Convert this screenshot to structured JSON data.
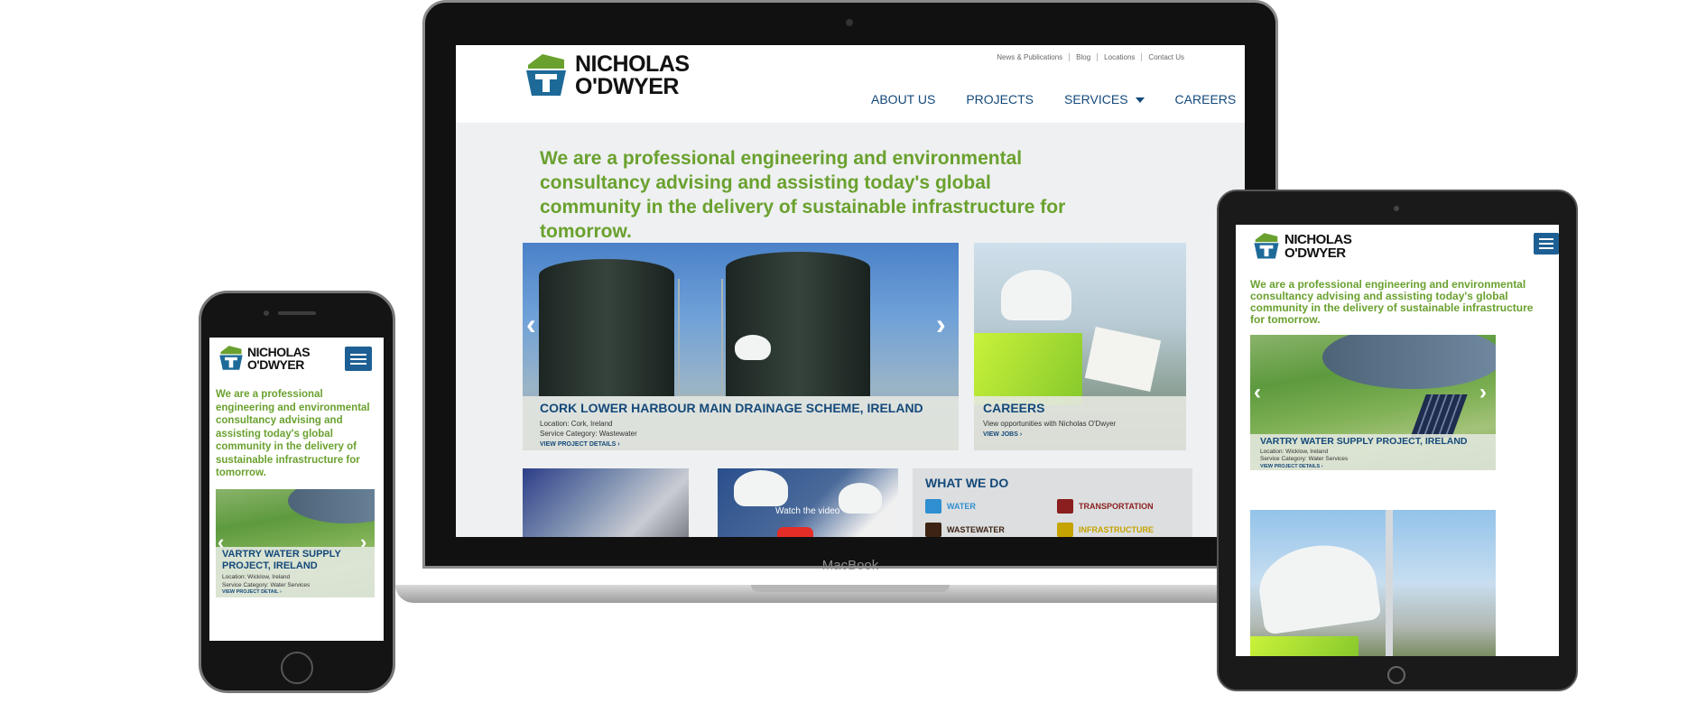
{
  "brand": {
    "name_line1": "NICHOLAS",
    "name_line2": "O'DWYER",
    "green": "#6aa12e",
    "blue": "#14497a"
  },
  "laptop": {
    "device_label": "MacBook",
    "top_links": [
      "News & Publications",
      "Blog",
      "Locations",
      "Contact Us"
    ],
    "nav": [
      "ABOUT US",
      "PROJECTS",
      "SERVICES",
      "CAREERS"
    ],
    "tagline": "We are a professional engineering and environmental consultancy advising and assisting today's global community in the delivery of sustainable infrastructure for tomorrow.",
    "project": {
      "title": "CORK LOWER HARBOUR MAIN DRAINAGE SCHEME, IRELAND",
      "location": "Location: Cork, Ireland",
      "category": "Service Category: Wastewater",
      "link": "VIEW PROJECT DETAILS ›"
    },
    "careers": {
      "title": "CAREERS",
      "subtitle": "View opportunities with Nicholas O'Dwyer",
      "link": "VIEW JOBS ›"
    },
    "video_label": "Watch the video",
    "what_we_do": {
      "title": "WHAT WE DO",
      "items": [
        {
          "label": "WATER",
          "color": "#2f8fd1",
          "icon": "water-tap-icon"
        },
        {
          "label": "TRANSPORTATION",
          "color": "#8b1e1e",
          "icon": "truck-icon"
        },
        {
          "label": "WASTEWATER",
          "color": "#3c2314",
          "icon": "pipe-icon"
        },
        {
          "label": "INFRASTRUCTURE",
          "color": "#c5a300",
          "icon": "road-icon"
        }
      ]
    }
  },
  "tablet": {
    "tagline": "We are a professional engineering and environmental consultancy advising and assisting today's global community in the delivery of sustainable infrastructure for tomorrow.",
    "project": {
      "title": "VARTRY WATER SUPPLY PROJECT, IRELAND",
      "location": "Location: Wicklow, Ireland",
      "category": "Service Category: Water Services",
      "link": "VIEW PROJECT DETAILS ›"
    }
  },
  "phone": {
    "tagline": "We are a professional engineering and environmental consultancy advising and assisting today's global community in the delivery of sustainable infrastructure for tomorrow.",
    "project": {
      "title": "VARTRY WATER SUPPLY PROJECT, IRELAND",
      "location": "Location: Wicklow, Ireland",
      "category": "Service Category: Water Services",
      "link": "VIEW PROJECT DETAIL ›"
    }
  }
}
